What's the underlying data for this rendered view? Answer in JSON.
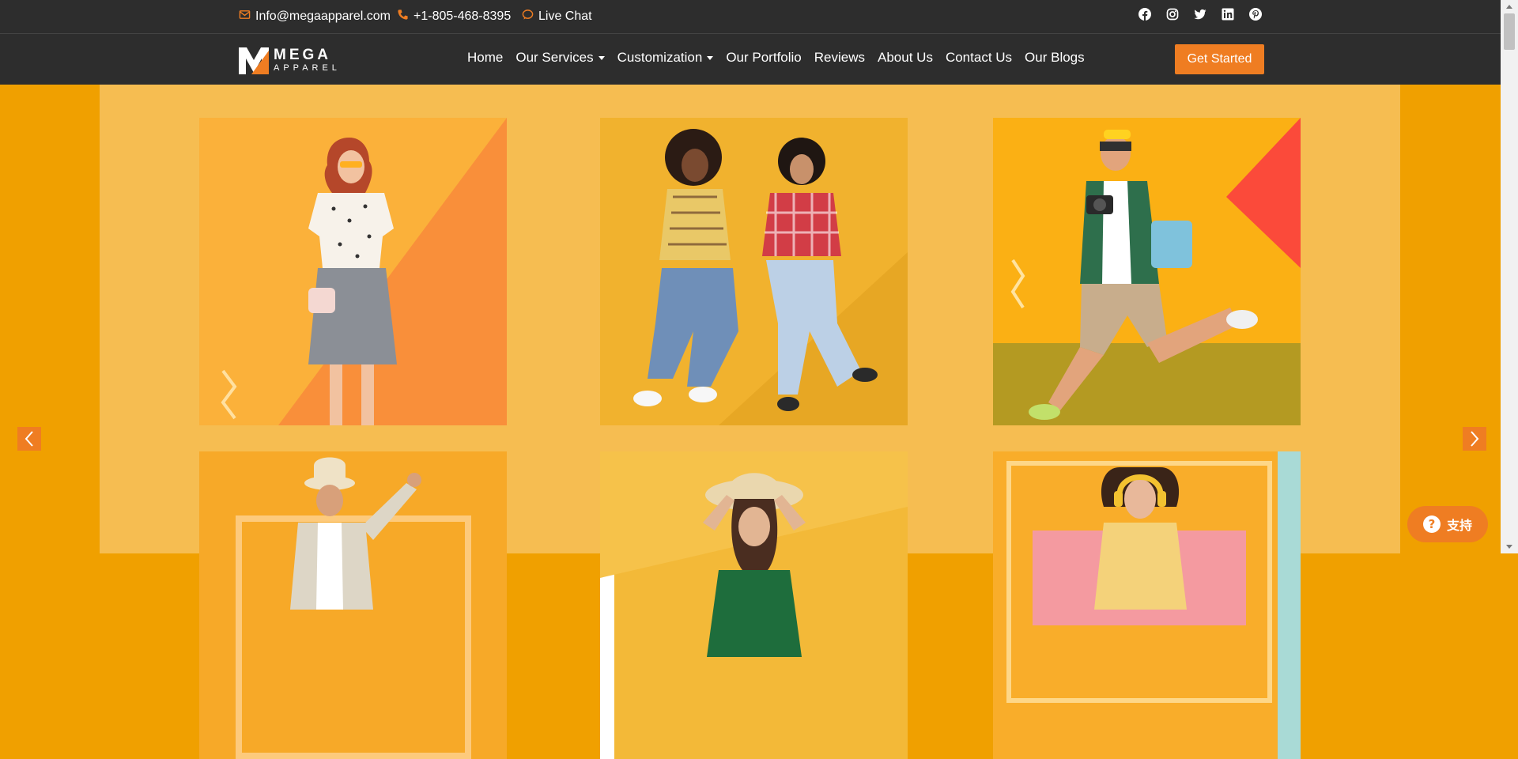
{
  "topbar": {
    "email": "Info@megaapparel.com",
    "phone": "+1-805-468-8395",
    "chat": "Live Chat",
    "socials": [
      "facebook-icon",
      "instagram-icon",
      "twitter-icon",
      "linkedin-icon",
      "pinterest-icon"
    ]
  },
  "logo": {
    "line1": "MEGA",
    "line2": "APPAREL"
  },
  "nav": {
    "items": [
      {
        "label": "Home"
      },
      {
        "label": "Our Services"
      },
      {
        "label": "Customization"
      },
      {
        "label": "Our Portfolio"
      },
      {
        "label": "Reviews"
      },
      {
        "label": "About Us"
      },
      {
        "label": "Contact Us"
      },
      {
        "label": "Our Blogs"
      }
    ],
    "cta": "Get Started"
  },
  "slider": {
    "tiles": [
      "woman-in-floral-top-photo",
      "two-women-jumping-photo",
      "man-with-camera-jumping-photo",
      "man-in-hat-dancing-photo",
      "woman-in-straw-hat-photo",
      "woman-with-headphones-photo"
    ]
  },
  "support": {
    "label": "支持"
  },
  "colors": {
    "accent": "#ef7d22",
    "header_bg": "#2d2d2d",
    "panel_bg": "#f6bd51",
    "outer_bg": "#f0a000"
  }
}
